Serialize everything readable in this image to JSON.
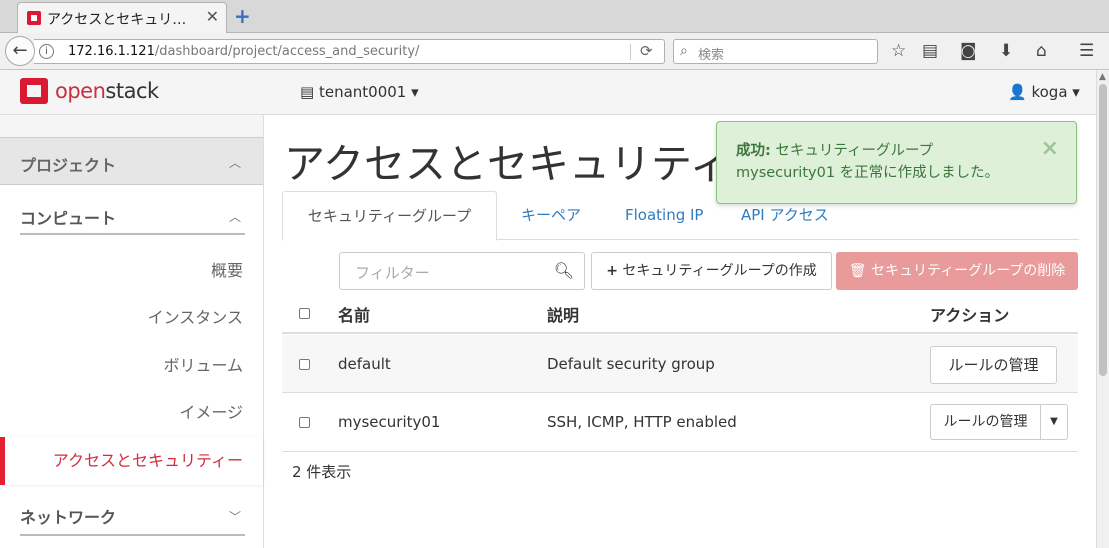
{
  "browser": {
    "tab_title": "アクセスとセキュリ…",
    "tab_close": "✕",
    "new_tab": "+",
    "url_host": "172.16.1.121",
    "url_path": "/dashboard/project/access_and_security/",
    "search_placeholder": "検索"
  },
  "header": {
    "logo_part1": "open",
    "logo_part2": "stack",
    "tenant": "tenant0001",
    "user": "koga"
  },
  "sidebar": {
    "project": "プロジェクト",
    "compute": "コンピュート",
    "items": [
      "概要",
      "インスタンス",
      "ボリューム",
      "イメージ",
      "アクセスとセキュリティー"
    ],
    "network": "ネットワーク"
  },
  "page": {
    "title": "アクセスとセキュリティ",
    "tabs": [
      "セキュリティーグループ",
      "キーペア",
      "Floating IP",
      "API アクセス"
    ],
    "filter_placeholder": "フィルター",
    "create_button": "セキュリティーグループの作成",
    "delete_button": "セキュリティーグループの削除"
  },
  "table": {
    "headers": {
      "name": "名前",
      "description": "説明",
      "actions": "アクション"
    },
    "rows": [
      {
        "name": "default",
        "description": "Default security group",
        "action": "ルールの管理"
      },
      {
        "name": "mysecurity01",
        "description": "SSH, ICMP, HTTP enabled",
        "action": "ルールの管理"
      }
    ],
    "count_text": "2 件表示"
  },
  "alert": {
    "title": "成功:",
    "message": "セキュリティーグループ mysecurity01 を正常に作成しました。",
    "close": "×"
  },
  "colors": {
    "brand_red": "#da1a32",
    "link_blue": "#2f7dc1",
    "alert_bg": "#dff0d8",
    "danger_btn": "#e99a9a"
  }
}
